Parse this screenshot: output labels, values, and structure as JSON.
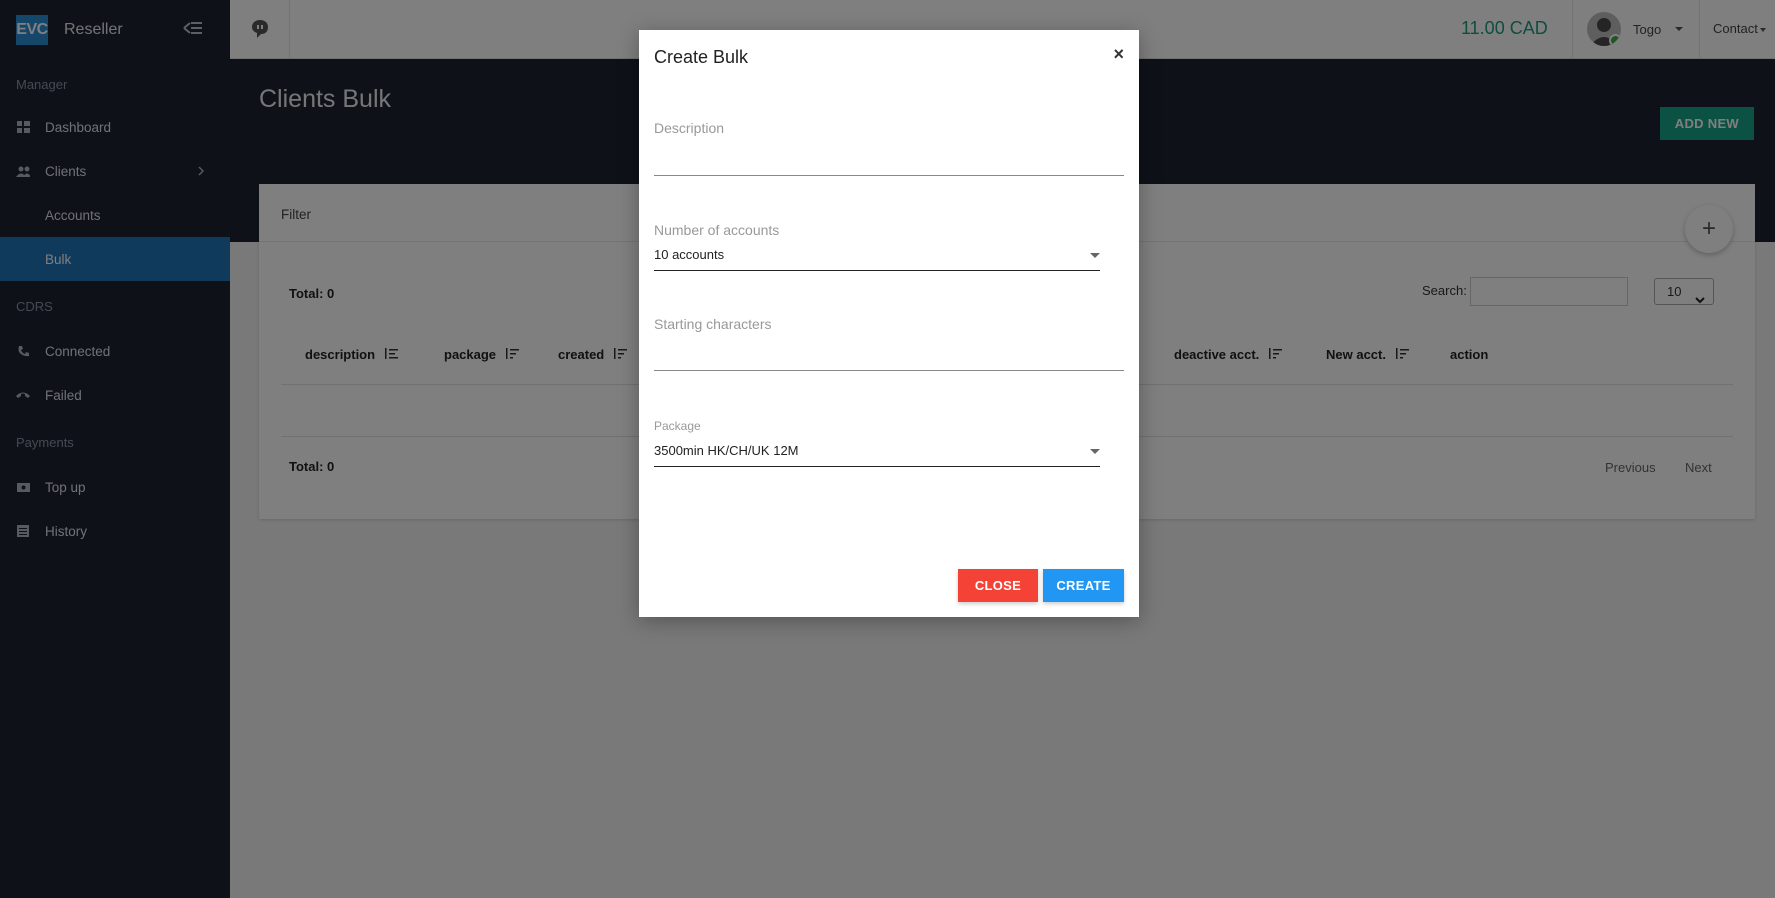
{
  "brand": {
    "logo": "EVC",
    "name": "Reseller"
  },
  "sidebar": {
    "sections": [
      {
        "title": "Manager"
      },
      {
        "title": "CDRS"
      },
      {
        "title": "Payments"
      }
    ],
    "items": [
      {
        "label": "Dashboard",
        "icon": "dashboard-icon"
      },
      {
        "label": "Clients",
        "icon": "users-icon"
      },
      {
        "label": "Accounts"
      },
      {
        "label": "Bulk"
      },
      {
        "label": "Connected",
        "icon": "phone-icon"
      },
      {
        "label": "Failed",
        "icon": "hangup-icon"
      },
      {
        "label": "Top up",
        "icon": "money-icon"
      },
      {
        "label": "History",
        "icon": "list-icon"
      }
    ]
  },
  "topbar": {
    "balance": "11.00 CAD",
    "user_name": "Togo",
    "contact": "Contact"
  },
  "page": {
    "title": "Clients Bulk",
    "add_new": "ADD NEW",
    "filter": "Filter",
    "total_top": "Total: 0",
    "total_bottom": "Total: 0",
    "search_label": "Search:",
    "page_length": "10",
    "columns": [
      "description",
      "package",
      "created",
      "deactive acct.",
      "New acct.",
      "action"
    ],
    "previous": "Previous",
    "next": "Next"
  },
  "modal": {
    "title": "Create Bulk",
    "close_x": "×",
    "description_label": "Description",
    "number_label": "Number of accounts",
    "number_value": "10 accounts",
    "starting_label": "Starting characters",
    "package_label": "Package",
    "package_value": "3500min HK/CH/UK 12M",
    "close_button": "CLOSE",
    "create_button": "CREATE"
  },
  "colors": {
    "sidebar_bg": "#1c2331",
    "active_item": "#1f74b9",
    "balance": "#1f9b7e",
    "add_new": "#17a589",
    "close_btn": "#f44336",
    "create_btn": "#2196f3"
  }
}
